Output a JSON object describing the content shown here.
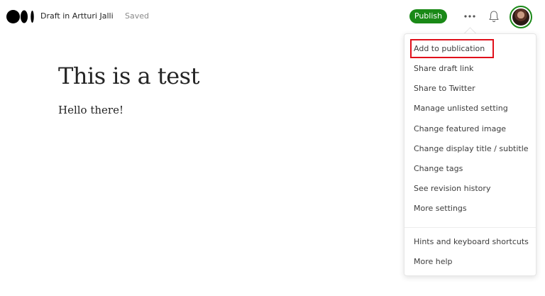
{
  "header": {
    "draft_label": "Draft in Artturi Jalli",
    "status": "Saved",
    "publish_label": "Publish",
    "more_label": "•••"
  },
  "content": {
    "title": "This is a test",
    "body": "Hello there!"
  },
  "menu": {
    "items": [
      "Add to publication",
      "Share draft link",
      "Share to Twitter",
      "Manage unlisted setting",
      "Change featured image",
      "Change display title / subtitle",
      "Change tags",
      "See revision history",
      "More settings"
    ],
    "footer_items": [
      "Hints and keyboard shortcuts",
      "More help"
    ]
  },
  "colors": {
    "accent": "#1a8917",
    "highlight": "#e0101b"
  },
  "icons": {
    "logo": "medium-logo-icon",
    "more": "more-icon",
    "bell": "bell-icon"
  }
}
